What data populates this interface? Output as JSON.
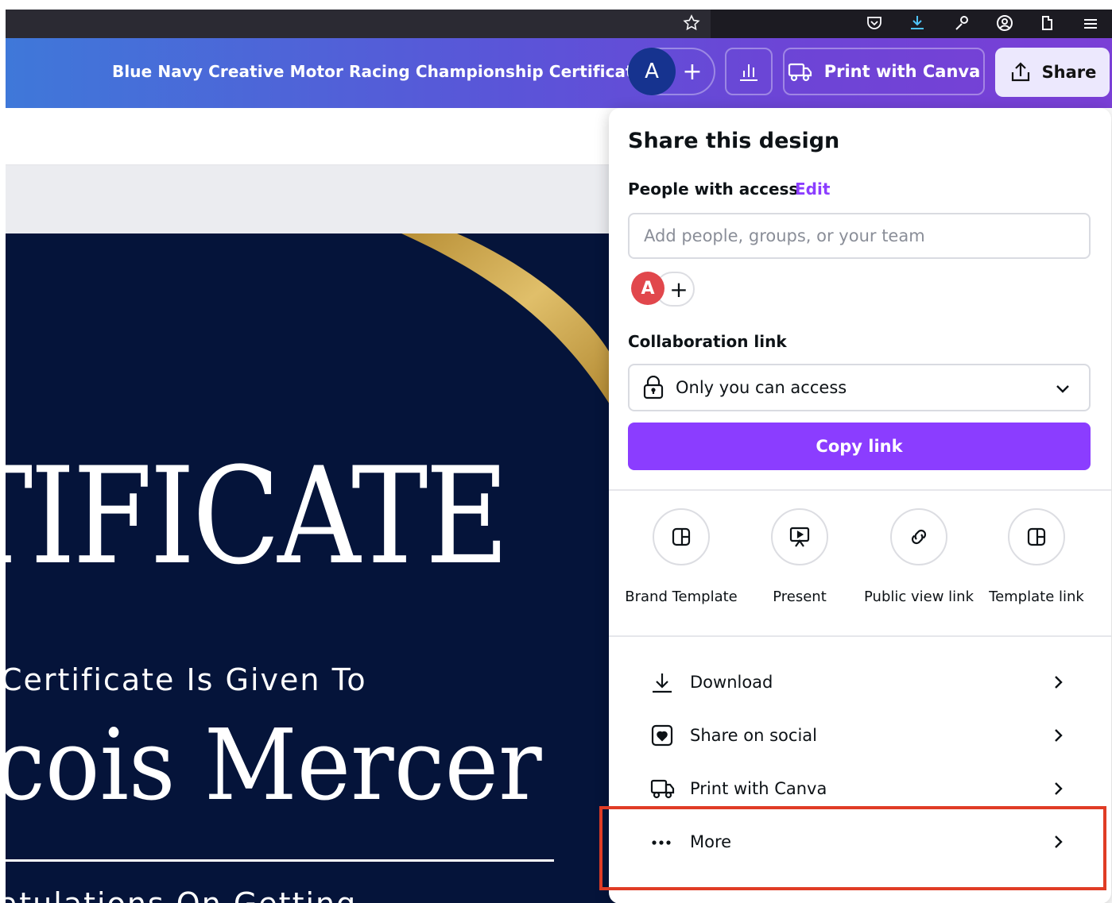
{
  "header": {
    "doc_title": "Blue Navy Creative Motor Racing Championship Certificate",
    "avatar_letter": "A",
    "add_collaborator": "+",
    "print_label": "Print with Canva",
    "share_label": "Share"
  },
  "certificate": {
    "title_text": "TIFICATE",
    "given_to": "Certificate Is Given To",
    "recipient": "cois Mercer",
    "congrats": "atulations On Getting"
  },
  "share_panel": {
    "title": "Share this design",
    "people_label": "People with access",
    "edit_label": "Edit",
    "add_people_placeholder": "Add people, groups, or your team",
    "avatar_letter": "A",
    "add_plus": "+",
    "collab_label": "Collaboration link",
    "access_value": "Only you can access",
    "copy_link": "Copy link",
    "options": [
      {
        "label": "Brand Template",
        "icon": "template-icon"
      },
      {
        "label": "Present",
        "icon": "present-icon"
      },
      {
        "label": "Public view link",
        "icon": "link-icon"
      },
      {
        "label": "Template link",
        "icon": "template-icon"
      }
    ],
    "rows": [
      {
        "label": "Download",
        "icon": "download-icon"
      },
      {
        "label": "Share on social",
        "icon": "social-heart-icon"
      },
      {
        "label": "Print with Canva",
        "icon": "truck-icon"
      },
      {
        "label": "More",
        "icon": "more-dots-icon"
      }
    ]
  },
  "colors": {
    "accent": "#8b3dff",
    "navy": "#05143a",
    "highlight": "#e03c25",
    "gold": "#c9a24a"
  }
}
